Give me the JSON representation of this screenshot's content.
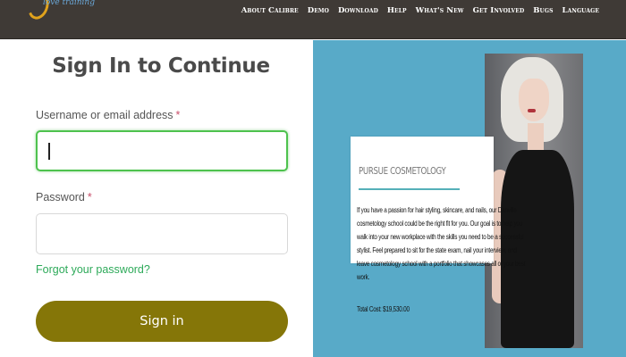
{
  "header": {
    "logo_tagline": "love training",
    "nav": [
      "About Calibre",
      "Demo",
      "Download",
      "Help",
      "What's New",
      "Get Involved",
      "Bugs",
      "Language"
    ]
  },
  "signin": {
    "title": "Sign In to Continue",
    "username_label": "Username or email address",
    "password_label": "Password",
    "required_mark": "*",
    "forgot_link": "Forgot your password?",
    "submit_label": "Sign in",
    "username_value": "",
    "password_value": ""
  },
  "ad": {
    "heading": "PURSUE COSMETOLOGY",
    "body": "If you have a passion for hair styling, skincare, and nails, our Danville cosmetology school could be the right fit for you. Our goal is to help you walk into your new workplace with the skills you need to be a successful stylist. Feel prepared to sit for the state exam, nail your interview, and leave cosmetology school with a portfolio that showcases all of your best work.",
    "cost": "Total Cost: $19,530.00"
  },
  "colors": {
    "topbar": "#3f3a36",
    "focus_border": "#4ec24e",
    "link": "#2eaa5a",
    "button": "#857608",
    "ad_background": "#58aac8"
  }
}
